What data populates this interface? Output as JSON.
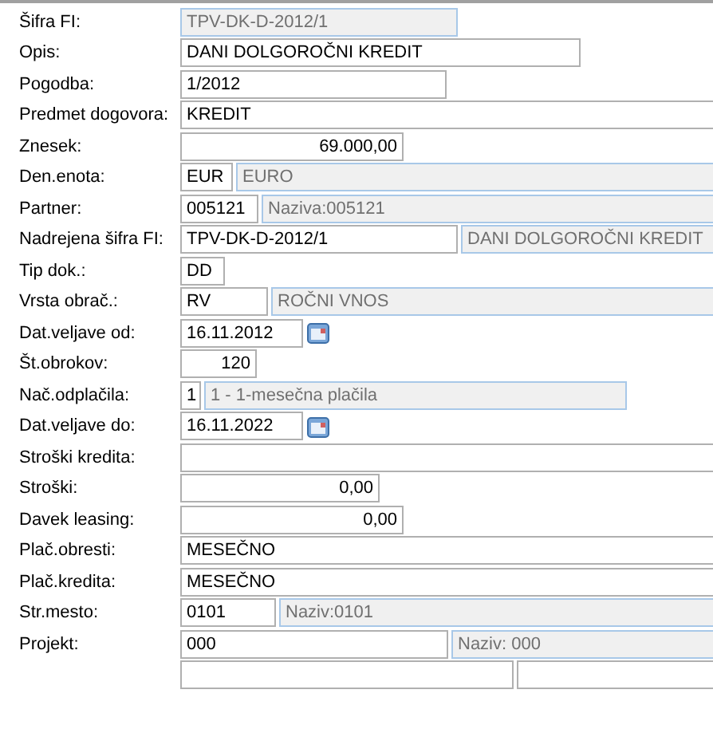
{
  "rows": [
    {
      "label": "Šifra FI:",
      "fields": [
        {
          "kind": "text",
          "value": "TPV-DK-D-2012/1",
          "readonly": true
        }
      ]
    },
    {
      "label": "Opis:",
      "fields": [
        {
          "kind": "text",
          "value": "DANI DOLGOROČNI KREDIT",
          "readonly": false
        }
      ]
    },
    {
      "label": "Pogodba:",
      "fields": [
        {
          "kind": "text",
          "value": "1/2012",
          "readonly": false
        }
      ]
    },
    {
      "label": "Predmet dogovora:",
      "fields": [
        {
          "kind": "text",
          "value": "KREDIT",
          "readonly": false
        }
      ]
    },
    {
      "label": "Znesek:",
      "fields": [
        {
          "kind": "number",
          "value": "69.000,00",
          "readonly": false
        }
      ]
    },
    {
      "label": "Den.enota:",
      "fields": [
        {
          "kind": "text",
          "value": "EUR",
          "readonly": false
        },
        {
          "kind": "text",
          "value": "EURO",
          "readonly": true
        }
      ]
    },
    {
      "label": "Partner:",
      "fields": [
        {
          "kind": "text",
          "value": "005121",
          "readonly": false
        },
        {
          "kind": "text",
          "value": "Naziva:005121",
          "readonly": true
        }
      ]
    },
    {
      "label": "Nadrejena šifra FI:",
      "fields": [
        {
          "kind": "text",
          "value": "TPV-DK-D-2012/1",
          "readonly": false
        },
        {
          "kind": "text",
          "value": "DANI DOLGOROČNI KREDIT",
          "readonly": true
        }
      ]
    },
    {
      "label": "Tip dok.:",
      "fields": [
        {
          "kind": "text",
          "value": "DD",
          "readonly": false
        }
      ]
    },
    {
      "label": "Vrsta obrač.:",
      "fields": [
        {
          "kind": "text",
          "value": "RV",
          "readonly": false
        },
        {
          "kind": "text",
          "value": "ROČNI VNOS",
          "readonly": true
        }
      ]
    },
    {
      "label": "Dat.veljave od:",
      "fields": [
        {
          "kind": "date",
          "value": "16.11.2012",
          "readonly": false
        }
      ]
    },
    {
      "label": "Št.obrokov:",
      "fields": [
        {
          "kind": "number",
          "value": "120",
          "readonly": false
        }
      ]
    },
    {
      "label": "Nač.odplačila:",
      "fields": [
        {
          "kind": "text",
          "value": "1",
          "readonly": false
        },
        {
          "kind": "text",
          "value": "1 - 1-mesečna plačila",
          "readonly": true
        }
      ]
    },
    {
      "label": "Dat.veljave do:",
      "fields": [
        {
          "kind": "date",
          "value": "16.11.2022",
          "readonly": false
        }
      ]
    },
    {
      "label": "Stroški kredita:",
      "fields": [
        {
          "kind": "text",
          "readonly": false
        }
      ]
    },
    {
      "label": "Stroški:",
      "fields": [
        {
          "kind": "number",
          "value": "0,00",
          "readonly": false
        }
      ]
    },
    {
      "label": "Davek leasing:",
      "fields": [
        {
          "kind": "number",
          "value": "0,00",
          "readonly": false
        }
      ]
    },
    {
      "label": "Plač.obresti:",
      "fields": [
        {
          "kind": "text",
          "value": "MESEČNO",
          "readonly": false
        }
      ]
    },
    {
      "label": "Plač.kredita:",
      "fields": [
        {
          "kind": "text",
          "value": "MESEČNO",
          "readonly": false
        }
      ]
    },
    {
      "label": "Str.mesto:",
      "fields": [
        {
          "kind": "text",
          "value": "0101",
          "readonly": false
        },
        {
          "kind": "text",
          "value": "Naziv:0101",
          "readonly": true
        }
      ]
    },
    {
      "label": "Projekt:",
      "fields": [
        {
          "kind": "text",
          "value": "000",
          "readonly": false
        },
        {
          "kind": "text",
          "value": "Naziv: 000",
          "readonly": true
        }
      ]
    },
    {
      "fields": [
        {
          "kind": "text",
          "readonly": false
        },
        {
          "kind": "text",
          "readonly": false
        }
      ]
    }
  ]
}
